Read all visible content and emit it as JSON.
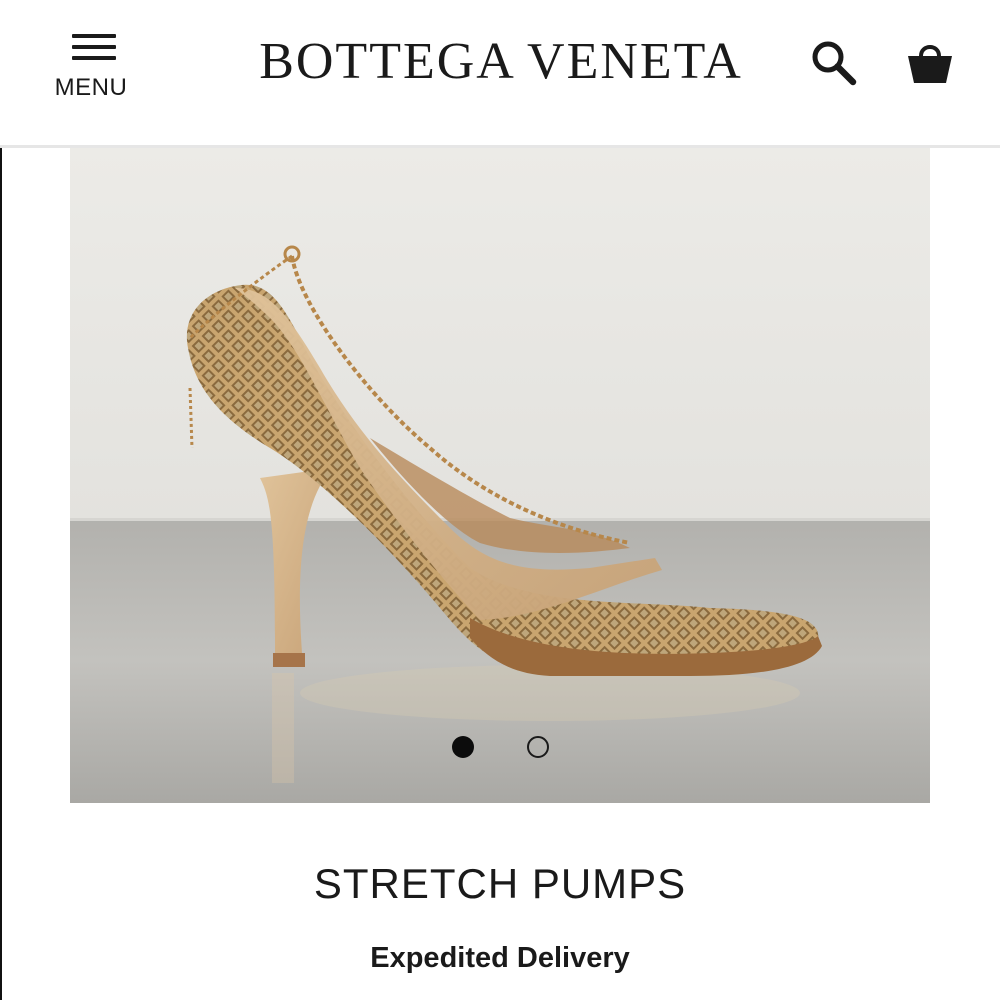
{
  "header": {
    "menu_label": "MENU",
    "brand": "BOTTEGA VENETA",
    "icons": {
      "menu": "hamburger-icon",
      "search": "search-icon",
      "cart": "shopping-bag-icon"
    }
  },
  "gallery": {
    "image_count": 2,
    "active_index": 0
  },
  "product": {
    "name": "STRETCH PUMPS",
    "delivery": "Expedited Delivery"
  },
  "colors": {
    "text": "#1a1a1a",
    "divider": "#e6e6e6",
    "shoe": "#d2b48a"
  }
}
